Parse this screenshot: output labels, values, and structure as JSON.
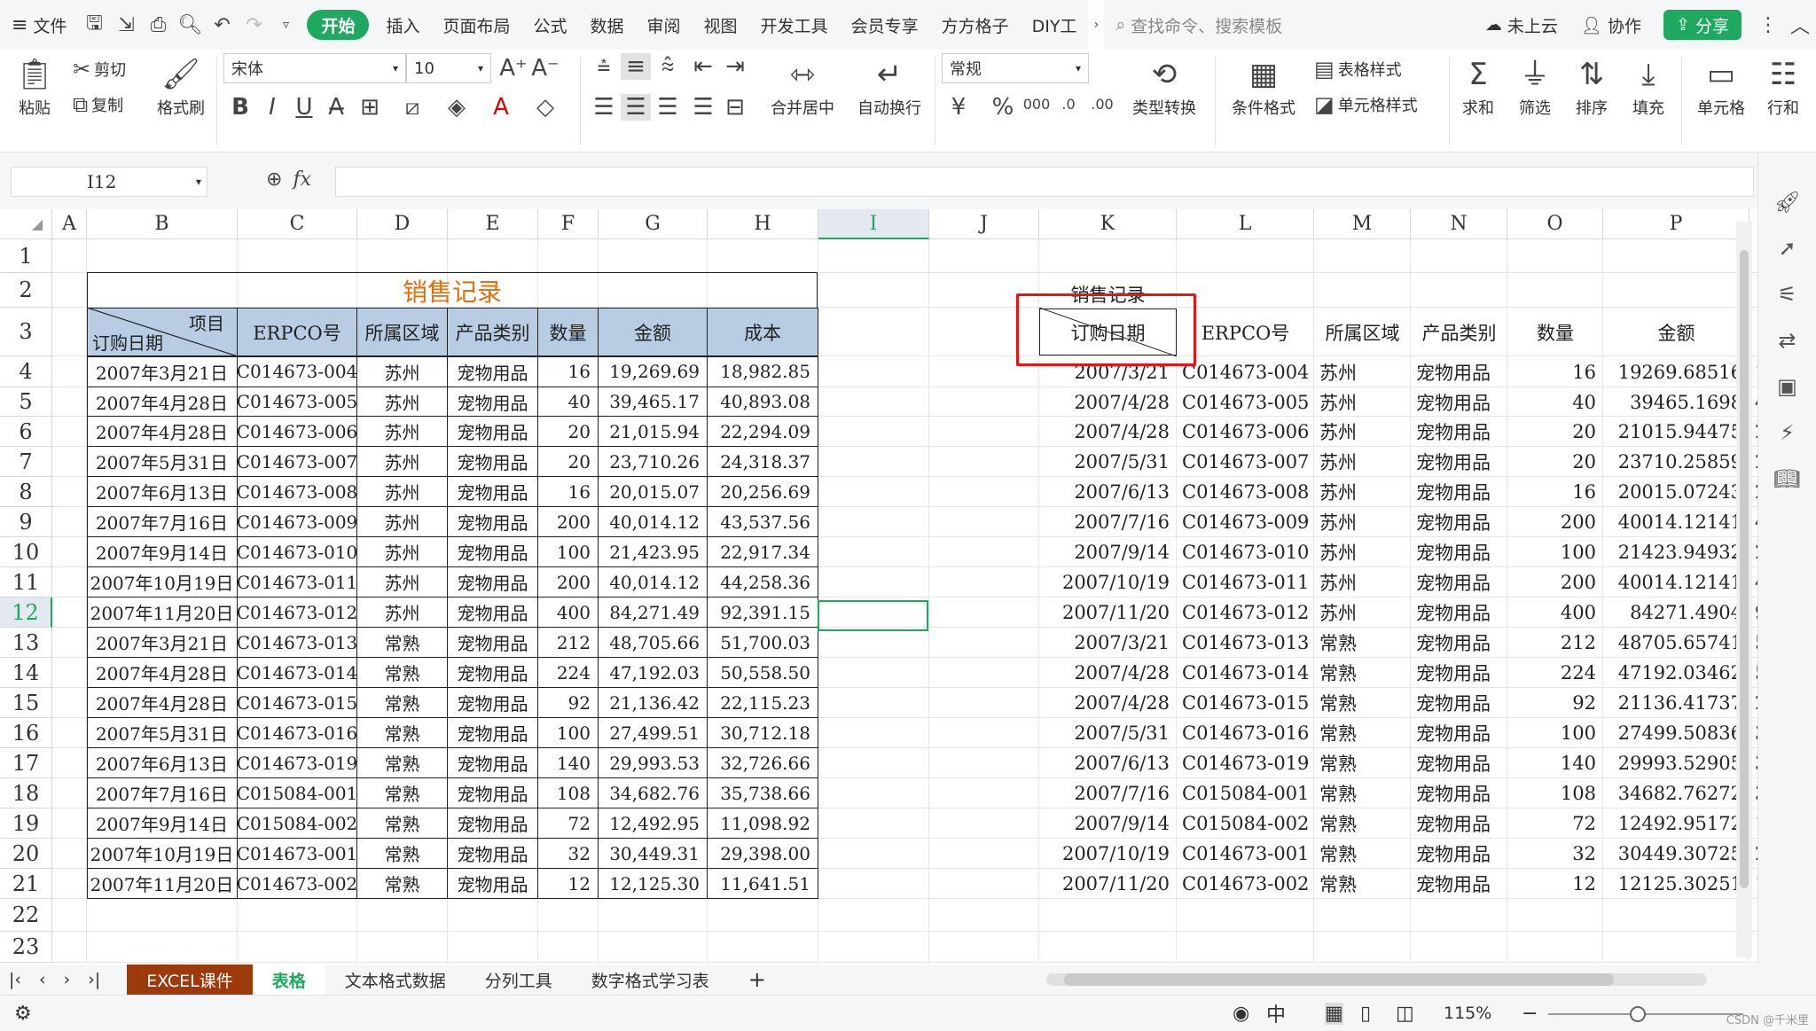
{
  "menubar": {
    "file": "文件",
    "tabs": [
      "开始",
      "插入",
      "页面布局",
      "公式",
      "数据",
      "审阅",
      "视图",
      "开发工具",
      "会员专享",
      "方方格子",
      "DIY工"
    ],
    "search": "查找命令、搜索模板",
    "cloud": "未上云",
    "collab": "协作",
    "share": "分享"
  },
  "ribbon": {
    "paste": "粘贴",
    "cut": "剪切",
    "copy": "复制",
    "format_painter": "格式刷",
    "font_name": "宋体",
    "font_size": "10",
    "merge_center": "合并居中",
    "wrap": "自动换行",
    "number_format": "常规",
    "type_convert": "类型转换",
    "cond_format": "条件格式",
    "table_style": "表格样式",
    "cell_style": "单元格样式",
    "sum": "求和",
    "filter": "筛选",
    "sort": "排序",
    "fill": "填充",
    "cell": "单元格",
    "row_col": "行和"
  },
  "formula_bar": {
    "name_box": "I12",
    "fx": "fx",
    "content": ""
  },
  "columns": [
    "A",
    "B",
    "C",
    "D",
    "E",
    "F",
    "G",
    "H",
    "I",
    "J",
    "K",
    "L",
    "M",
    "N",
    "O",
    "P"
  ],
  "rows": [
    "1",
    "2",
    "3",
    "4",
    "5",
    "6",
    "7",
    "8",
    "9",
    "10",
    "11",
    "12",
    "13",
    "14",
    "15",
    "16",
    "17",
    "18",
    "19",
    "20",
    "21",
    "22",
    "23"
  ],
  "left_table": {
    "title": "销售记录",
    "diag_top": "项目",
    "diag_bottom": "订购日期",
    "headers": [
      "ERPCO号",
      "所属区域",
      "产品类别",
      "数量",
      "金额",
      "成本"
    ],
    "rows": [
      [
        "2007年3月21日",
        "C014673-004",
        "苏州",
        "宠物用品",
        "16",
        "19,269.69",
        "18,982.85"
      ],
      [
        "2007年4月28日",
        "C014673-005",
        "苏州",
        "宠物用品",
        "40",
        "39,465.17",
        "40,893.08"
      ],
      [
        "2007年4月28日",
        "C014673-006",
        "苏州",
        "宠物用品",
        "20",
        "21,015.94",
        "22,294.09"
      ],
      [
        "2007年5月31日",
        "C014673-007",
        "苏州",
        "宠物用品",
        "20",
        "23,710.26",
        "24,318.37"
      ],
      [
        "2007年6月13日",
        "C014673-008",
        "苏州",
        "宠物用品",
        "16",
        "20,015.07",
        "20,256.69"
      ],
      [
        "2007年7月16日",
        "C014673-009",
        "苏州",
        "宠物用品",
        "200",
        "40,014.12",
        "43,537.56"
      ],
      [
        "2007年9月14日",
        "C014673-010",
        "苏州",
        "宠物用品",
        "100",
        "21,423.95",
        "22,917.34"
      ],
      [
        "2007年10月19日",
        "C014673-011",
        "苏州",
        "宠物用品",
        "200",
        "40,014.12",
        "44,258.36"
      ],
      [
        "2007年11月20日",
        "C014673-012",
        "苏州",
        "宠物用品",
        "400",
        "84,271.49",
        "92,391.15"
      ],
      [
        "2007年3月21日",
        "C014673-013",
        "常熟",
        "宠物用品",
        "212",
        "48,705.66",
        "51,700.03"
      ],
      [
        "2007年4月28日",
        "C014673-014",
        "常熟",
        "宠物用品",
        "224",
        "47,192.03",
        "50,558.50"
      ],
      [
        "2007年4月28日",
        "C014673-015",
        "常熟",
        "宠物用品",
        "92",
        "21,136.42",
        "22,115.23"
      ],
      [
        "2007年5月31日",
        "C014673-016",
        "常熟",
        "宠物用品",
        "100",
        "27,499.51",
        "30,712.18"
      ],
      [
        "2007年6月13日",
        "C014673-019",
        "常熟",
        "宠物用品",
        "140",
        "29,993.53",
        "32,726.66"
      ],
      [
        "2007年7月16日",
        "C015084-001",
        "常熟",
        "宠物用品",
        "108",
        "34,682.76",
        "35,738.66"
      ],
      [
        "2007年9月14日",
        "C015084-002",
        "常熟",
        "宠物用品",
        "72",
        "12,492.95",
        "11,098.92"
      ],
      [
        "2007年10月19日",
        "C014673-001",
        "常熟",
        "宠物用品",
        "32",
        "30,449.31",
        "29,398.00"
      ],
      [
        "2007年11月20日",
        "C014673-002",
        "常熟",
        "宠物用品",
        "12",
        "12,125.30",
        "11,641.51"
      ]
    ]
  },
  "right_table": {
    "title": "销售记录",
    "headers": [
      "订购日期",
      "ERPCO号",
      "所属区域",
      "产品类别",
      "数量",
      "金额"
    ],
    "rows": [
      [
        "2007/3/21",
        "C014673-004",
        "苏州",
        "宠物用品",
        "16",
        "19269.68516",
        "1"
      ],
      [
        "2007/4/28",
        "C014673-005",
        "苏州",
        "宠物用品",
        "40",
        "39465.1698",
        "4"
      ],
      [
        "2007/4/28",
        "C014673-006",
        "苏州",
        "宠物用品",
        "20",
        "21015.94475",
        "2"
      ],
      [
        "2007/5/31",
        "C014673-007",
        "苏州",
        "宠物用品",
        "20",
        "23710.25859",
        "2"
      ],
      [
        "2007/6/13",
        "C014673-008",
        "苏州",
        "宠物用品",
        "16",
        "20015.07243",
        "2"
      ],
      [
        "2007/7/16",
        "C014673-009",
        "苏州",
        "宠物用品",
        "200",
        "40014.12141",
        "4"
      ],
      [
        "2007/9/14",
        "C014673-010",
        "苏州",
        "宠物用品",
        "100",
        "21423.94932",
        "2"
      ],
      [
        "2007/10/19",
        "C014673-011",
        "苏州",
        "宠物用品",
        "200",
        "40014.12141",
        "4"
      ],
      [
        "2007/11/20",
        "C014673-012",
        "苏州",
        "宠物用品",
        "400",
        "84271.4904",
        "9"
      ],
      [
        "2007/3/21",
        "C014673-013",
        "常熟",
        "宠物用品",
        "212",
        "48705.65741",
        "5"
      ],
      [
        "2007/4/28",
        "C014673-014",
        "常熟",
        "宠物用品",
        "224",
        "47192.03462",
        "5"
      ],
      [
        "2007/4/28",
        "C014673-015",
        "常熟",
        "宠物用品",
        "92",
        "21136.41737",
        "2"
      ],
      [
        "2007/5/31",
        "C014673-016",
        "常熟",
        "宠物用品",
        "100",
        "27499.50836",
        "3"
      ],
      [
        "2007/6/13",
        "C014673-019",
        "常熟",
        "宠物用品",
        "140",
        "29993.52905",
        "3"
      ],
      [
        "2007/7/16",
        "C015084-001",
        "常熟",
        "宠物用品",
        "108",
        "34682.76272",
        "3"
      ],
      [
        "2007/9/14",
        "C015084-002",
        "常熟",
        "宠物用品",
        "72",
        "12492.95172",
        "1"
      ],
      [
        "2007/10/19",
        "C014673-001",
        "常熟",
        "宠物用品",
        "32",
        "30449.30725",
        "2"
      ],
      [
        "2007/11/20",
        "C014673-002",
        "常熟",
        "宠物用品",
        "12",
        "12125.30251",
        "1"
      ]
    ]
  },
  "sheet_tabs": [
    "EXCEL课件",
    "表格",
    "文本格式数据",
    "分列工具",
    "数字格式学习表"
  ],
  "status": {
    "zoom": "115%",
    "watermark": "CSDN @千米里"
  },
  "colors": {
    "accent": "#1fa85f",
    "header_fill": "#b8cce4",
    "title_orange": "#e46c0a",
    "highlight_red": "#e11111",
    "excel_tab": "#9c3a0c"
  }
}
